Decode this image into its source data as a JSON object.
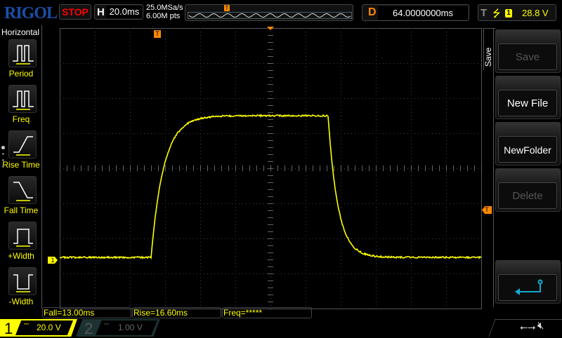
{
  "header": {
    "logo": "RIGOL",
    "run_state": "STOP",
    "horizontal_key": "H",
    "timebase": "20.0ms",
    "sample_rate": "25.0MSa/s",
    "memory_depth": "6.00M pts",
    "delay_key": "D",
    "delay": "64.0000000ms",
    "trigger_key": "T",
    "trigger_edge": "rising-edge-icon",
    "trigger_source": "1",
    "trigger_level": "28.8 V"
  },
  "left_menu": {
    "title": "Horizontal",
    "items": [
      {
        "label": "Period",
        "icon": "period-icon"
      },
      {
        "label": "Freq",
        "icon": "freq-icon"
      },
      {
        "label": "Rise Time",
        "icon": "rise-time-icon"
      },
      {
        "label": "Fall Time",
        "icon": "fall-time-icon"
      },
      {
        "label": "+Width",
        "icon": "positive-width-icon"
      },
      {
        "label": "-Width",
        "icon": "negative-width-icon"
      }
    ]
  },
  "right_menu": {
    "title": "Save",
    "buttons": [
      {
        "label": "Save",
        "enabled": false
      },
      {
        "label": "New File",
        "enabled": true
      },
      {
        "label": "NewFolder",
        "enabled": true
      },
      {
        "label": "Delete",
        "enabled": false
      }
    ],
    "back_icon": "return-icon"
  },
  "measurements": [
    {
      "text": "Fall=13.00ms"
    },
    {
      "text": "Rise=16.60ms"
    },
    {
      "text": "Freq=*****"
    }
  ],
  "channels": [
    {
      "num": "1",
      "coupling": "DC",
      "scale": "20.0 V",
      "active": true
    },
    {
      "num": "2",
      "coupling": "DC",
      "scale": "1.00 V",
      "active": false
    }
  ],
  "markers": {
    "trigger_pos": "T",
    "trigger_level": "T",
    "ch1_ground": "1"
  },
  "status_icons": [
    "usb-icon",
    "mute-icon"
  ],
  "colors": {
    "ch1": "#ffff00",
    "trigger": "#ff8c1a",
    "logo": "#1a4fa8",
    "stop": "#ff0000",
    "return": "#00aaff"
  }
}
